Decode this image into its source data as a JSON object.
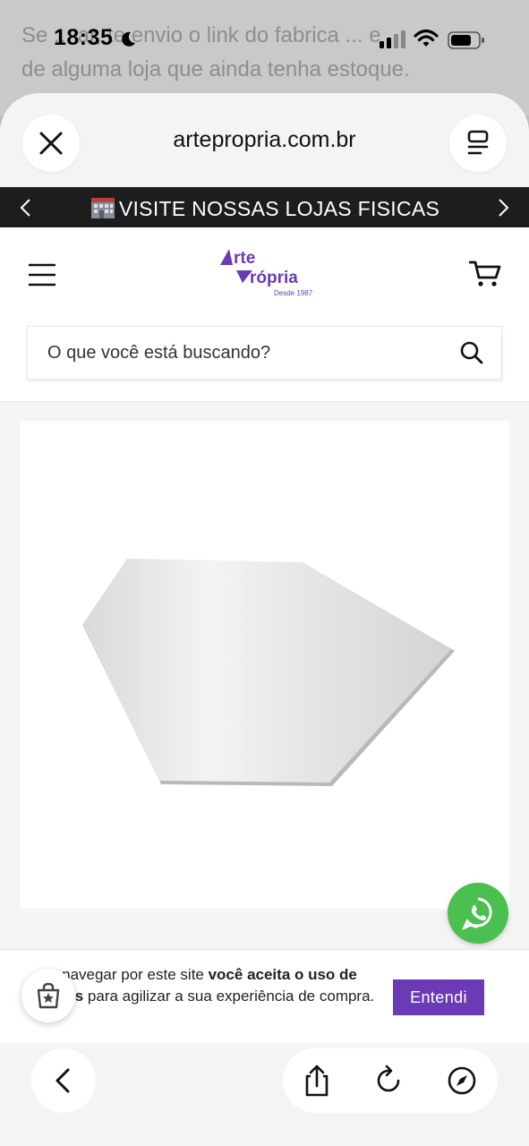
{
  "background_chat": {
    "line1": "Se ... ar, te envio o link do fabrica ... e",
    "line2": "de alguma loja que ainda tenha estoque."
  },
  "status_bar": {
    "time": "18:35"
  },
  "browser": {
    "url": "artepropria.com.br"
  },
  "promo_bar": {
    "text": "VISITE NOSSAS LOJAS FISICAS"
  },
  "site": {
    "logo_line1": "rte",
    "logo_line2": "rópria",
    "logo_sub": "Desde 1987",
    "brand_color": "#6a3bb5"
  },
  "search": {
    "placeholder": "O que você está buscando?"
  },
  "cookie_bar": {
    "text_part1": "navegar por este site ",
    "text_bold1": "você aceita o uso de",
    "text_bold2": "okies",
    "text_part2": " para agilizar a sua experiência de compra.",
    "button_label": "Entendi"
  },
  "colors": {
    "whatsapp_green": "#4bbf4f",
    "promo_bg": "#1d1d1d"
  }
}
